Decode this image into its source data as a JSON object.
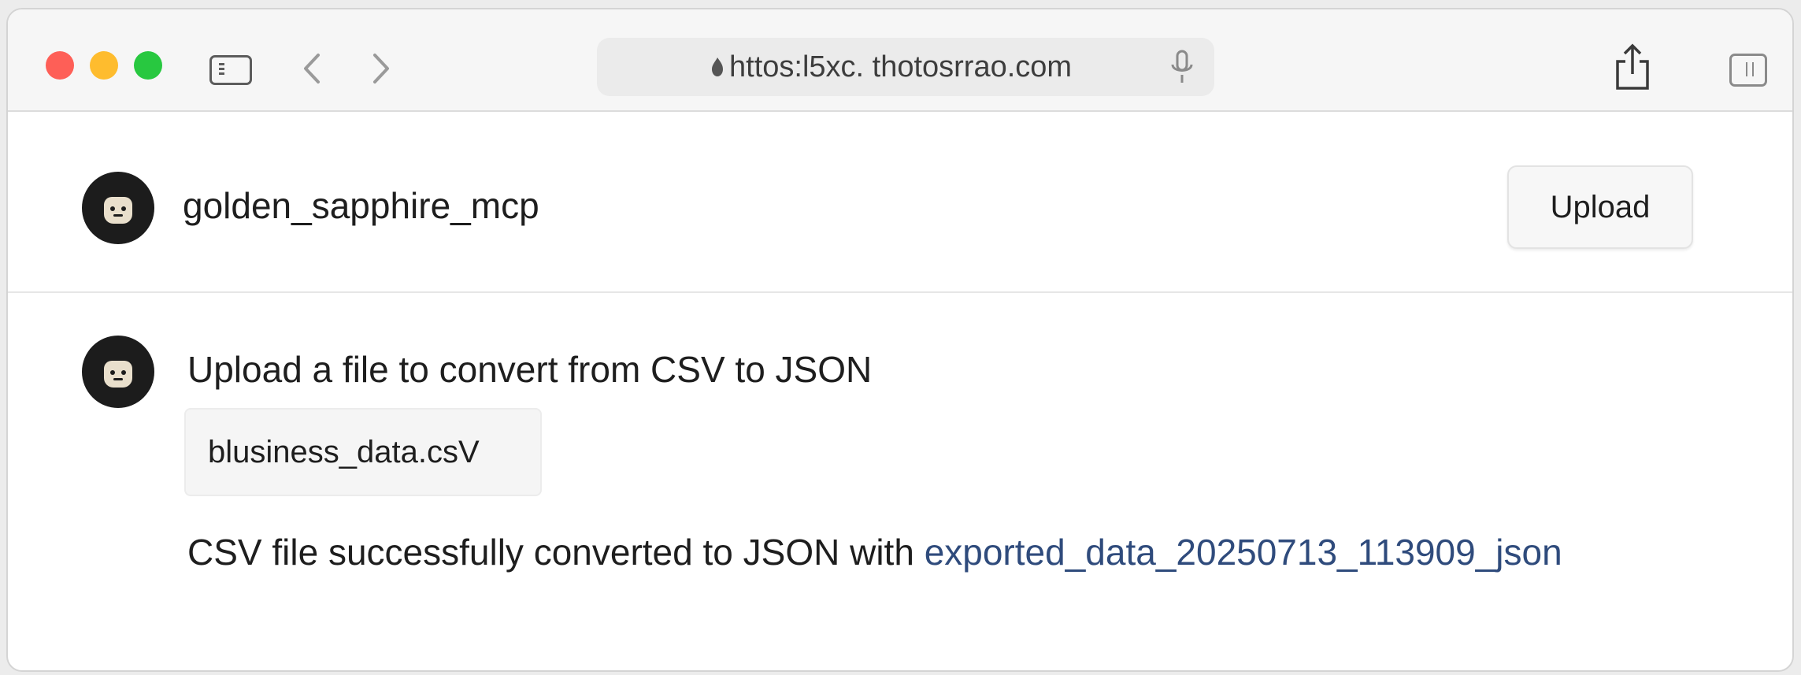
{
  "browser": {
    "url": "httos:l5xc. thotosrrao.com",
    "icons": {
      "sidebar": "sidebar-icon",
      "back": "chevron-left-icon",
      "forward": "chevron-right-icon",
      "lock": "lock-icon",
      "mic": "microphone-icon",
      "share": "share-icon",
      "tabs": "tabs-overview-icon"
    },
    "traffic_lights": [
      "#fe5f57",
      "#febc2e",
      "#28c840"
    ]
  },
  "header": {
    "username": "golden_sapphire_mcp",
    "upload_label": "Upload"
  },
  "message": {
    "text": "Upload a file to convert from CSV to JSON",
    "file_name": "blusiness_data.csV",
    "result_prefix": "CSV file successfully converted to JSON with ",
    "result_link": "exported_data_20250713_113909_json"
  },
  "colors": {
    "link": "#2f4b7c",
    "avatar": "#1c1c1c"
  }
}
